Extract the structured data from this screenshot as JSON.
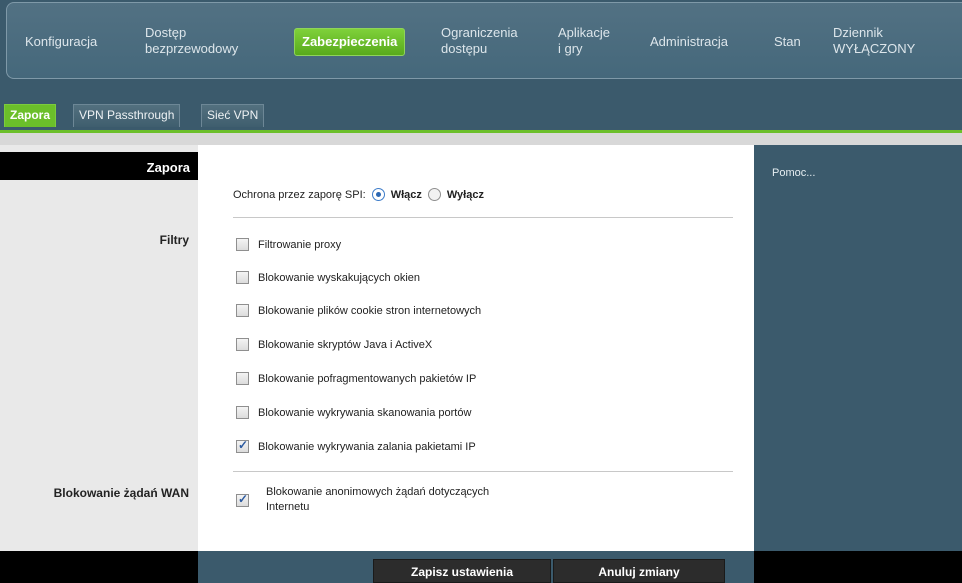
{
  "nav": {
    "items": [
      {
        "label": "Konfiguracja"
      },
      {
        "label": "Dostęp\nbezprzewodowy"
      },
      {
        "label": "Zabezpieczenia"
      },
      {
        "label": "Ograniczenia\ndostępu"
      },
      {
        "label": "Aplikacje\ni gry"
      },
      {
        "label": "Administracja"
      },
      {
        "label": "Stan"
      },
      {
        "label": "Dziennik\nWYŁĄCZONY"
      }
    ],
    "active_index": 2
  },
  "subtabs": [
    {
      "label": "Zapora",
      "active": true
    },
    {
      "label": "VPN Passthrough",
      "active": false
    },
    {
      "label": "Sieć VPN",
      "active": false
    }
  ],
  "left": {
    "header": "Zapora",
    "filters_label": "Filtry",
    "wan_label": "Blokowanie żądań WAN"
  },
  "spi": {
    "label": "Ochrona przez zaporę SPI:",
    "enable_label": "Włącz",
    "disable_label": "Wyłącz",
    "selected": "enable"
  },
  "filters": [
    {
      "label": "Filtrowanie proxy",
      "checked": false
    },
    {
      "label": "Blokowanie wyskakujących okien",
      "checked": false
    },
    {
      "label": "Blokowanie plików cookie stron internetowych",
      "checked": false
    },
    {
      "label": "Blokowanie skryptów Java i ActiveX",
      "checked": false
    },
    {
      "label": "Blokowanie pofragmentowanych pakietów IP",
      "checked": false
    },
    {
      "label": "Blokowanie wykrywania skanowania portów",
      "checked": false
    },
    {
      "label": "Blokowanie wykrywania zalania pakietami IP",
      "checked": true
    }
  ],
  "wan": {
    "label_line1": "Blokowanie anonimowych żądań dotyczących",
    "label_line2": "Internetu",
    "checked": true
  },
  "help": {
    "label": "Pomoc..."
  },
  "buttons": {
    "save": "Zapisz ustawienia",
    "cancel": "Anuluj zmiany"
  },
  "colors": {
    "nav_bg": "#4a6b7e",
    "accent_green": "#6bbf2a",
    "panel_blue": "#3b5a6c"
  }
}
